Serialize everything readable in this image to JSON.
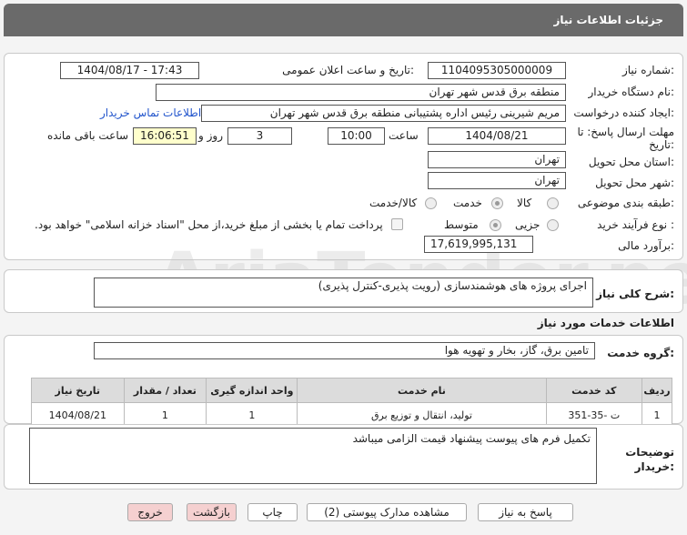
{
  "header": {
    "title": "جزئیات اطلاعات نیاز"
  },
  "watermark": {
    "text": "AriaTender.neT"
  },
  "form": {
    "need_number_label": "شماره نیاز:",
    "need_number": "1104095305000009",
    "announce_label": "تاریخ و ساعت اعلان عمومی:",
    "announce_value": "1404/08/17 - 17:43",
    "buyer_org_label": "نام دستگاه خریدار:",
    "buyer_org": "منطقه برق قدس شهر تهران",
    "requester_label": "ایجاد کننده درخواست:",
    "requester": "مریم شیرینی رئیس اداره پشتیبانی منطقه برق قدس شهر تهران",
    "contact_link": "اطلاعات تماس خریدار",
    "deadline_label_1": "مهلت ارسال پاسخ: تا",
    "deadline_label_2": "تاریخ:",
    "deadline_date": "1404/08/21",
    "time_label": "ساعت",
    "deadline_time": "10:00",
    "days_value": "3",
    "days_label": "روز و",
    "remaining_time": "16:06:51",
    "remaining_label": "ساعت باقی مانده",
    "province_label": "استان محل تحویل:",
    "province": "تهران",
    "city_label": "شهر محل تحویل:",
    "city": "تهران",
    "category_label": "طبقه بندی موضوعی:",
    "category_options": [
      "کالا",
      "خدمت",
      "کالا/خدمت"
    ],
    "process_label": "نوع فرآیند خرید :",
    "process_options": [
      "جزیی",
      "متوسط"
    ],
    "payment_note": "پرداخت تمام یا بخشی از مبلغ خرید،از محل \"اسناد خزانه اسلامی\" خواهد بود.",
    "estimate_label": "برآورد مالی:",
    "estimate": "17,619,995,131"
  },
  "description": {
    "label": "شرح کلی نیاز:",
    "text": "اجرای پروژه های هوشمندسازی (رویت پذیری-کنترل پذیری)"
  },
  "services": {
    "section_title": "اطلاعات خدمات مورد نیاز",
    "group_label": "گروه خدمت:",
    "group_value": "تامین برق، گاز، بخار و تهویه هوا",
    "columns": [
      "ردیف",
      "کد خدمت",
      "نام خدمت",
      "واحد اندازه گیری",
      "تعداد / مقدار",
      "تاریخ نیاز"
    ],
    "rows": [
      [
        "1",
        "ت -35-351",
        "تولید، انتقال و توزیع برق",
        "1",
        "1",
        "1404/08/21"
      ]
    ]
  },
  "buyer_notes": {
    "label": "توضیحات خریدار:",
    "text": "تکمیل  فرم های پیوست پیشنهاد قیمت الزامی میباشد"
  },
  "buttons": {
    "reply": "پاسخ به نیاز",
    "attachments": "مشاهده مدارک پیوستی (2)",
    "print": "چاپ",
    "back": "بازگشت",
    "exit": "خروج"
  }
}
